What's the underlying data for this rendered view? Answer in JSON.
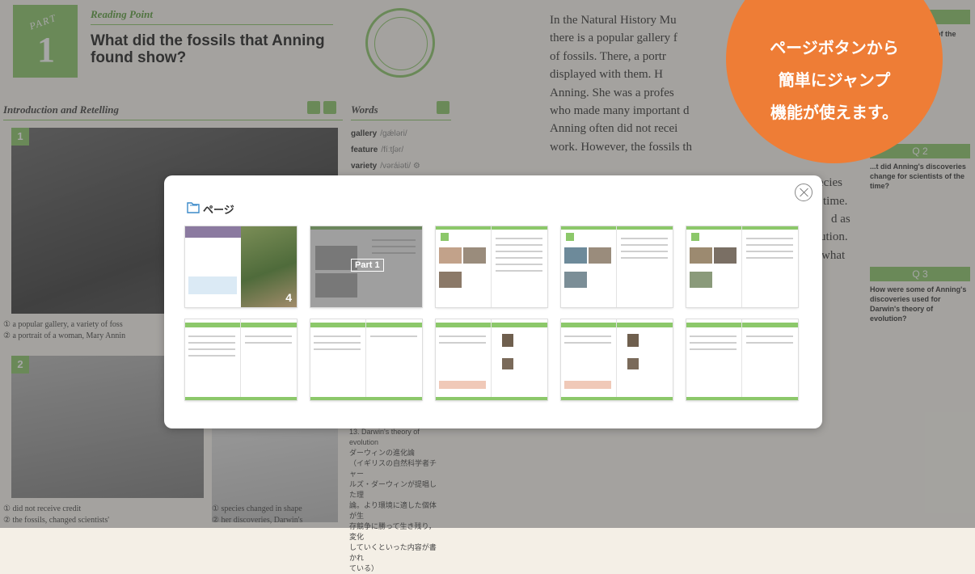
{
  "textbook": {
    "part_word": "PART",
    "part_number": "1",
    "reading_point": "Reading Point",
    "main_question": "What did the fossils that Anning found show?",
    "section_heading": "Introduction and Retelling",
    "words_heading": "Words",
    "words": [
      {
        "word": "gallery",
        "pron": "/ɡǽləri/"
      },
      {
        "word": "feature",
        "pron": "/fíːtʃər/"
      },
      {
        "word": "variety",
        "pron": "/vəráiəti/ ⚙"
      }
    ],
    "photo_numbers": [
      "1",
      "2"
    ],
    "captions": [
      "① a popular gallery, a variety of foss",
      "② a portrait of a woman, Mary Annin",
      "① did not receive credit",
      "② the fossils, changed scientists'",
      "① species changed in shape",
      "② her discoveries, Darwin's"
    ],
    "note_lines": [
      "13. Darwin's theory of",
      "evolution",
      "ダーウィンの進化論",
      "（イギリスの自然科学者チャー",
      "ルズ・ダーウィンが提唱した理",
      "論。より環境に適した個体が生",
      "存競争に勝って生き残り，変化",
      "していくといった内容が書かれ",
      "ている）"
    ],
    "body_lines": [
      "In the Natural History Mu",
      "there is a popular gallery f",
      "of fossils.  There, a portr",
      "displayed with them.     H",
      "Anning.  She was a profes",
      "who made many important d",
      "Anning often did not recei",
      "work.  However, the fossils th",
      "",
      "ecies",
      "time.",
      "d as",
      "ution.",
      "what"
    ],
    "questions": [
      {
        "label": "Q 1",
        "text": "...it is ...useum. ...s of the"
      },
      {
        "label": "Q 2",
        "text": "...t did Anning's discoveries change for scientists of the time?"
      },
      {
        "label": "Q 3",
        "text": "How were some of Anning's discoveries used for Darwin's theory of evolution?"
      }
    ]
  },
  "callout": {
    "line1": "ページボタンから",
    "line2": "簡単にジャンプ",
    "line3": "機能が使えます。"
  },
  "modal": {
    "title": "ページ",
    "active_thumb_label": "Part 1",
    "cover_page_number": "4"
  },
  "colors": {
    "accent_green": "#8cc86a",
    "callout_orange": "#ee7d36"
  }
}
